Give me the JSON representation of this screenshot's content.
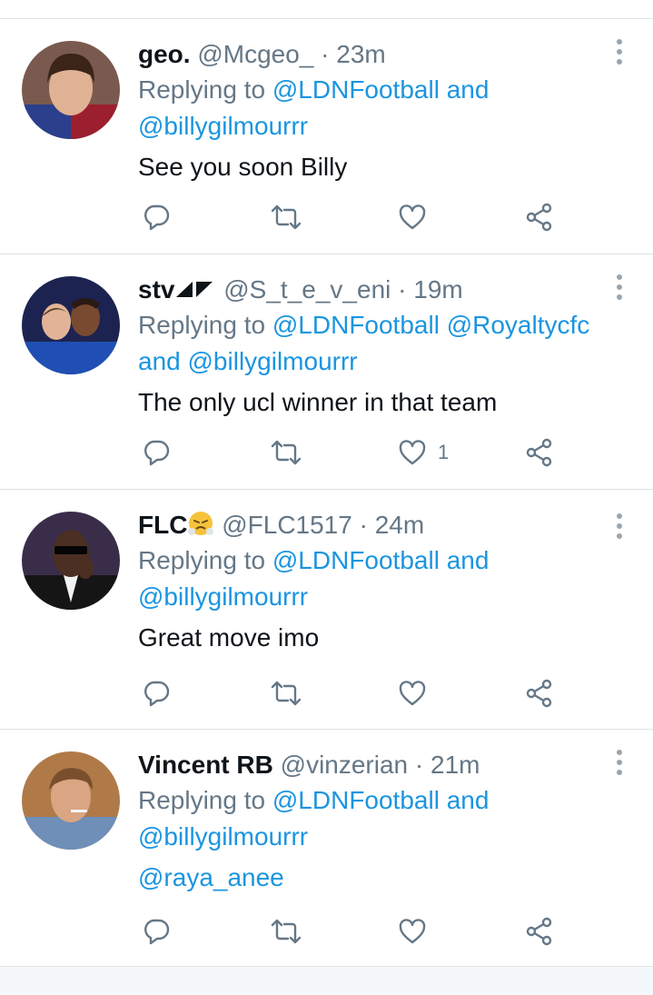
{
  "tweets": [
    {
      "name": "geo.",
      "handle": "@Mcgeo_",
      "dot": "·",
      "time": "23m",
      "replying_prefix": "Replying to",
      "mentions_line1": [
        "@LDNFootball"
      ],
      "line1_suffix": "and",
      "mentions_line2": [
        "@billygilmourrr"
      ],
      "line2_prefix": "",
      "body": "See you soon Billy",
      "like_count": ""
    },
    {
      "name": "stv",
      "handle": "@S_t_e_v_eni",
      "dot": "·",
      "time": "19m",
      "replying_prefix": "Replying to",
      "mentions_line1": [
        "@LDNFootball",
        "@Royaltycfc"
      ],
      "line1_suffix": "",
      "line2_prefix": "and",
      "mentions_line2": [
        "@billygilmourrr"
      ],
      "body": "The only ucl winner in that team",
      "like_count": "1"
    },
    {
      "name": "FLC",
      "handle": "@FLC1517",
      "dot": "·",
      "time": "24m",
      "replying_prefix": "Replying to",
      "mentions_line1": [
        "@LDNFootball"
      ],
      "line1_suffix": "and",
      "mentions_line2": [
        "@billygilmourrr"
      ],
      "line2_prefix": "",
      "body": "Great move imo",
      "like_count": ""
    },
    {
      "name": "Vincent RB",
      "handle": "@vinzerian",
      "dot": "·",
      "time": "21m",
      "replying_prefix": "Replying to",
      "mentions_line1": [
        "@LDNFootball"
      ],
      "line1_suffix": "and",
      "mentions_line2": [
        "@billygilmourrr"
      ],
      "line2_prefix": "",
      "body": "@raya_anee",
      "like_count": ""
    }
  ],
  "colors": {
    "link": "#1b95e0",
    "secondary": "#657786",
    "divider": "#dfe3e6"
  },
  "icons": [
    "reply-icon",
    "retweet-icon",
    "like-icon",
    "share-icon",
    "more-icon"
  ]
}
